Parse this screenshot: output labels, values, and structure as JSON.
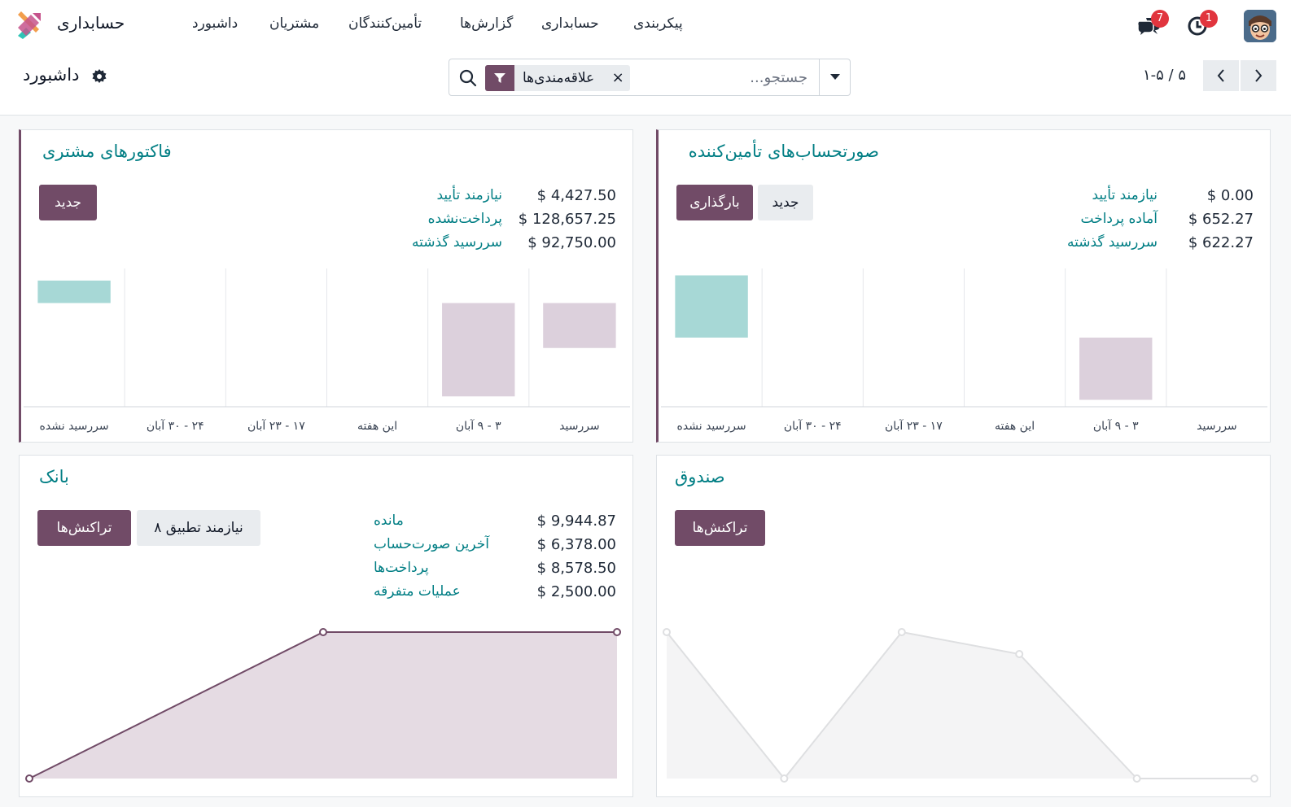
{
  "navbar": {
    "app_name": "حسابداری",
    "menu": [
      "داشبورد",
      "مشتریان",
      "تأمین‌کنندگان",
      "گزارش‌ها",
      "حسابداری",
      "پیکربندی"
    ],
    "messages_count": "7",
    "activities_count": "1"
  },
  "control": {
    "breadcrumb": "داشبورد",
    "search": {
      "placeholder": "جستجو...",
      "facet": "علاقه‌مندی‌ها"
    },
    "pager": "۱-۵ / ۵"
  },
  "colors": {
    "primary": "#714b67",
    "accent": "#017e84",
    "posBar": "#a7d8d6",
    "negBar": "#dcd0dc"
  },
  "cards": {
    "customer": {
      "title": "فاکتورهای مشتری",
      "btn_new": "جدید",
      "kpis": [
        {
          "label": "نیازمند تأیید",
          "value": "$ 4,427.50"
        },
        {
          "label": "پرداخت‌نشده",
          "value": "$ 128,657.25"
        },
        {
          "label": "سررسید گذشته",
          "value": "$ 92,750.00"
        }
      ]
    },
    "vendor": {
      "title": "صورتحساب‌های تأمین‌کننده",
      "btn_upload": "بارگذاری",
      "btn_new": "جدید",
      "kpis": [
        {
          "label": "نیازمند تأیید",
          "value": "$ 0.00"
        },
        {
          "label": "آماده پرداخت",
          "value": "$ 652.27"
        },
        {
          "label": "سررسید گذشته",
          "value": "$ 622.27"
        }
      ]
    },
    "bank": {
      "title": "بانک",
      "btn_transactions": "تراکنش‌ها",
      "btn_reconcile": "نیازمند تطبیق ۸",
      "kpis": [
        {
          "label": "مانده",
          "value": "$ 9,944.87"
        },
        {
          "label": "آخرین صورت‌حساب",
          "value": "$ 6,378.00"
        },
        {
          "label": "پرداخت‌ها",
          "value": "$ 8,578.50"
        },
        {
          "label": "عملیات متفرقه",
          "value": "$ 2,500.00"
        }
      ]
    },
    "cash": {
      "title": "صندوق",
      "btn_transactions": "تراکنش‌ها"
    }
  },
  "chart_data": [
    {
      "type": "bar",
      "chart": "customer_invoices",
      "categories": [
        "سررسید",
        "۳ - ۹ آبان",
        "این هفته",
        "۱۷ - ۲۳ آبان",
        "۲۴ - ۳۰ آبان",
        "سررسید نشده"
      ],
      "values": [
        -2.6,
        -5.4,
        0,
        0,
        0,
        1.3
      ],
      "ylim": [
        -6,
        2
      ]
    },
    {
      "type": "bar",
      "chart": "vendor_bills",
      "categories": [
        "سررسید",
        "۳ - ۹ آبان",
        "این هفته",
        "۱۷ - ۲۳ آبان",
        "۲۴ - ۳۰ آبان",
        "سررسید نشده"
      ],
      "values": [
        0,
        -1.8,
        0,
        0,
        0,
        1.8
      ],
      "ylim": [
        -2,
        2
      ]
    },
    {
      "type": "area",
      "chart": "bank_balance",
      "x": [
        0,
        1,
        2
      ],
      "values": [
        0,
        10,
        10
      ],
      "ylim": [
        0,
        11
      ]
    },
    {
      "type": "area",
      "chart": "cash_balance",
      "x": [
        0,
        1,
        2,
        3,
        4,
        5
      ],
      "values": [
        10,
        0,
        10,
        8.5,
        0,
        0
      ],
      "ylim": [
        0,
        11
      ]
    }
  ]
}
